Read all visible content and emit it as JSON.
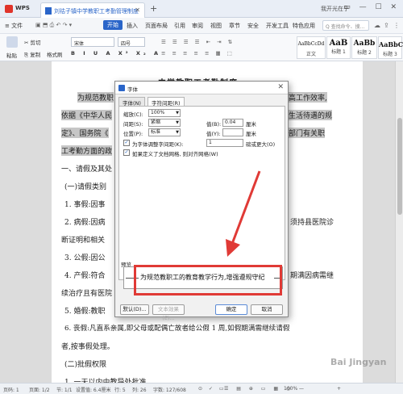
{
  "titlebar": {
    "app_name": "WPS",
    "doc_tab": "刘祜子镇中学教职工考勤管理制度",
    "user": "我开光在乎",
    "win_controls": "▭ — ☐ ✕"
  },
  "menu": {
    "file": "≡ 文件",
    "items": [
      "开始",
      "插入",
      "页面布局",
      "引用",
      "审阅",
      "视图",
      "章节",
      "安全",
      "开发工具",
      "特色应用"
    ],
    "active": "开始",
    "search": "Q 查找命令、搜..."
  },
  "ribbon": {
    "paste": "粘贴",
    "cut": "剪切",
    "copy": "复制",
    "format_painter": "格式刷",
    "font": "宋体",
    "size": "四号",
    "styles": [
      {
        "sample": "AaBbCcDd",
        "name": "正文"
      },
      {
        "sample": "AaB",
        "name": "标题 1"
      },
      {
        "sample": "AaBb",
        "name": "标题 2"
      },
      {
        "sample": "AaBbC",
        "name": "标题 3"
      }
    ]
  },
  "document": {
    "title": "中学教职工考勤制度",
    "lines": [
      {
        "text": "为规范教职",
        "tail": "高工作效率,"
      },
      {
        "text": "依据《中华人民",
        "tail": "生活待遇的规"
      },
      {
        "text": "定》、国务院《",
        "tail": "部门有关职"
      },
      {
        "text": "工考勤方面的政",
        "tail": ""
      },
      {
        "text": "一、请假及其处",
        "tail": ""
      },
      {
        "text": "(一)请假类别",
        "tail": ""
      },
      {
        "text": "1. 事假:因事",
        "tail": ""
      },
      {
        "text": "2. 病假:因病",
        "tail": "须持县医院诊"
      },
      {
        "text": "断证明和相关",
        "tail": ""
      },
      {
        "text": "3. 公假:因公",
        "tail": ""
      },
      {
        "text": "4. 产假:符合",
        "tail": "期满因病需继"
      },
      {
        "text": "续治疗且有医院",
        "tail": ""
      },
      {
        "text": "5. 婚假:教职",
        "tail": ""
      },
      {
        "text": "6. 丧假:凡直系亲属,即父母或配偶亡故者给公假 1 周,如假期满需继续请假",
        "tail": ""
      },
      {
        "text": "者,按事假处理。",
        "tail": ""
      },
      {
        "text": "(二)批假权限",
        "tail": ""
      },
      {
        "text": "1. 一天以内由教导处批准",
        "tail": ""
      }
    ]
  },
  "dialog": {
    "title": "字体",
    "tabs": [
      "字体(N)",
      "字符间距(R)"
    ],
    "active_tab": "字符间距(R)",
    "scale_label": "缩放(C):",
    "scale_value": "100%",
    "spacing_label": "间距(S):",
    "spacing_value": "紧缩",
    "spacing_by_label": "值(B):",
    "spacing_by_value": "0.04",
    "spacing_unit": "厘米",
    "position_label": "位置(P):",
    "position_value": "标准",
    "position_by_label": "值(Y):",
    "position_unit": "厘米",
    "kerning_label": "为字体调整字间距(K):",
    "kerning_value": "1",
    "kerning_tail": "磅或更大(O)",
    "grid_label": "如果定义了文档网格, 则对齐网格(W)",
    "kerning_checked": true,
    "grid_checked": true,
    "preview_label": "预览",
    "preview_text": "为规范教职工的教育教学行为,增强遵规守纪",
    "default_btn": "默认(D)...",
    "text_effect_btn": "文本效果(E)...",
    "ok_btn": "确定",
    "cancel_btn": "取消"
  },
  "status": {
    "page": "页码: 1",
    "pages": "页面: 1/2",
    "section": "节: 1/1",
    "setting": "设置值: 6.4厘米",
    "row": "行: 5",
    "col": "列: 26",
    "words": "字数: 127/608",
    "zoom": "100% —",
    "zoom_plus": "+"
  },
  "watermark": "Bai Jingyan",
  "annotation_color": "#e03a36"
}
